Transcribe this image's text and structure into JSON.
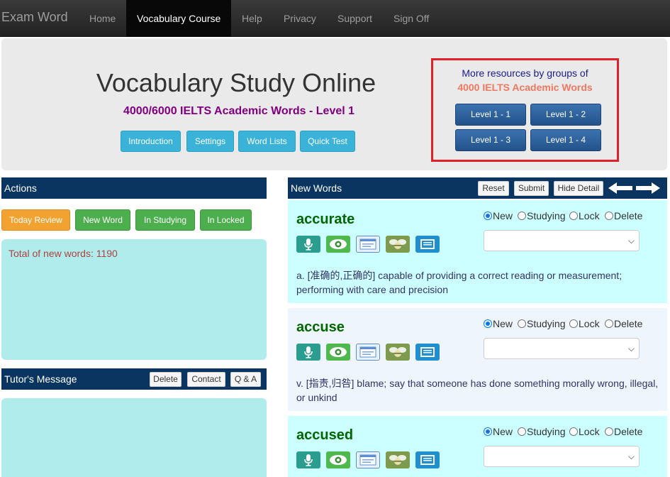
{
  "nav": {
    "brand": "Exam Word",
    "items": [
      {
        "label": "Home"
      },
      {
        "label": "Vocabulary Course"
      },
      {
        "label": "Help"
      },
      {
        "label": "Privacy"
      },
      {
        "label": "Support"
      },
      {
        "label": "Sign Off"
      }
    ],
    "active_index": 1
  },
  "hero": {
    "title": "Vocabulary Study Online",
    "subtitle": "4000/6000 IELTS Academic Words - Level 1",
    "buttons": [
      {
        "label": "Introduction"
      },
      {
        "label": "Settings"
      },
      {
        "label": "Word Lists"
      },
      {
        "label": "Quick Test"
      }
    ]
  },
  "resources": {
    "line1": "More resources by groups of",
    "line2": "4000 IELTS Academic Words",
    "levels": [
      {
        "label": "Level 1 - 1"
      },
      {
        "label": "Level 1 - 2"
      },
      {
        "label": "Level 1 - 3"
      },
      {
        "label": "Level 1 - 4"
      }
    ]
  },
  "actions": {
    "title": "Actions",
    "buttons": [
      {
        "label": "Today Review"
      },
      {
        "label": "New Word"
      },
      {
        "label": "In Studying"
      },
      {
        "label": "In Locked"
      }
    ],
    "total_text": "Total of new words: 1190"
  },
  "tutor": {
    "title": "Tutor's Message",
    "buttons": [
      {
        "label": "Delete"
      },
      {
        "label": "Contact"
      },
      {
        "label": "Q & A"
      }
    ]
  },
  "new_words": {
    "title": "New Words",
    "buttons": [
      {
        "label": "Reset"
      },
      {
        "label": "Submit"
      },
      {
        "label": "Hide Detail"
      }
    ],
    "status_options": [
      "New",
      "Studying",
      "Lock",
      "Delete"
    ],
    "words": [
      {
        "word": "accurate",
        "definition": "a. [准确的,正确的] capable of providing a correct reading or measurement; performing with care and precision",
        "status": "New"
      },
      {
        "word": "accuse",
        "definition": "v. [指责,归咎] blame; say that someone has done something morally wrong, illegal, or unkind",
        "status": "New"
      },
      {
        "word": "accused",
        "definition": "",
        "status": "New"
      }
    ]
  },
  "colors": {
    "navbar": "#222222",
    "panel_header": "#0a3560",
    "highlight_box": "#e0202a",
    "word_green": "#006600",
    "card_cyan": "#ccffff",
    "card_light": "#eef5fc"
  }
}
